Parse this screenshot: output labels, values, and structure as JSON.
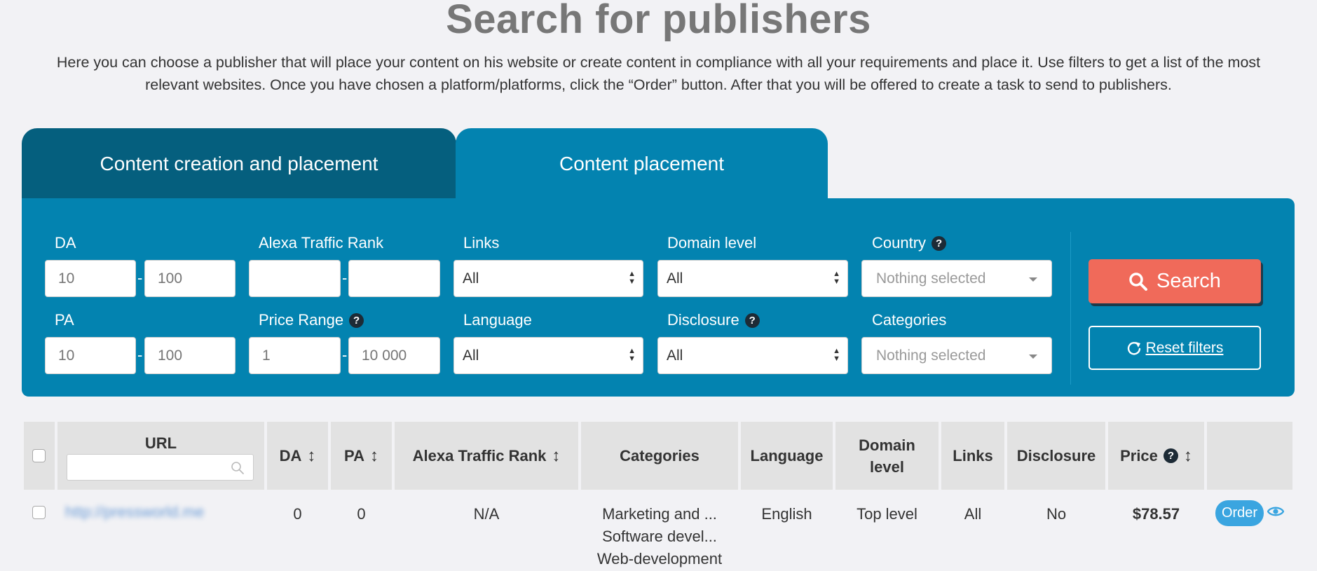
{
  "page": {
    "title": "Search for publishers",
    "intro_line1": "Here you can choose a publisher that will place your content on his website or create content in compliance with all your requirements and place it. Use filters to get a list of the most",
    "intro_line2": "relevant websites. Once you have chosen a platform/platforms, click the “Order” button. After that you will be offered to create a task to send to publishers."
  },
  "tabs": [
    {
      "label": "Content creation and placement",
      "active": false
    },
    {
      "label": "Content placement",
      "active": true
    }
  ],
  "filters": {
    "da": {
      "label": "DA",
      "min_placeholder": "10",
      "max_placeholder": "100"
    },
    "pa": {
      "label": "PA",
      "min_placeholder": "10",
      "max_placeholder": "100"
    },
    "alexa": {
      "label": "Alexa Traffic Rank",
      "min_placeholder": "",
      "max_placeholder": ""
    },
    "price": {
      "label": "Price Range",
      "min_placeholder": "1",
      "max_placeholder": "10 000"
    },
    "links": {
      "label": "Links",
      "value": "All"
    },
    "language": {
      "label": "Language",
      "value": "All"
    },
    "domain_level": {
      "label": "Domain level",
      "value": "All"
    },
    "disclosure": {
      "label": "Disclosure",
      "value": "All"
    },
    "country": {
      "label": "Country",
      "value": "Nothing selected"
    },
    "categories": {
      "label": "Categories",
      "value": "Nothing selected"
    },
    "range_separator": "-"
  },
  "buttons": {
    "search": "Search",
    "reset": "Reset filters"
  },
  "table": {
    "headers": {
      "url": "URL",
      "da": "DA",
      "pa": "PA",
      "alexa": "Alexa Traffic Rank",
      "categories": "Categories",
      "language": "Language",
      "domain_level_1": "Domain",
      "domain_level_2": "level",
      "links": "Links",
      "disclosure": "Disclosure",
      "price": "Price"
    },
    "sort_icon": "↕",
    "rows": [
      {
        "url": "http://pressworld.me",
        "da": "0",
        "pa": "0",
        "alexa": "N/A",
        "categories": [
          "Marketing and ...",
          "Software devel...",
          "Web-development"
        ],
        "language": "English",
        "domain_level": "Top level",
        "links": "All",
        "disclosure": "No",
        "price": "$78.57",
        "order_label": "Order"
      }
    ]
  },
  "icons": {
    "help": "question-circle-icon",
    "search": "magnifier-icon",
    "reset": "refresh-icon",
    "view": "eye-icon"
  },
  "colors": {
    "tab_inactive": "#055f7e",
    "tab_active": "#0383b0",
    "search_button": "#f06a5a",
    "order_button": "#3aa5e0"
  }
}
